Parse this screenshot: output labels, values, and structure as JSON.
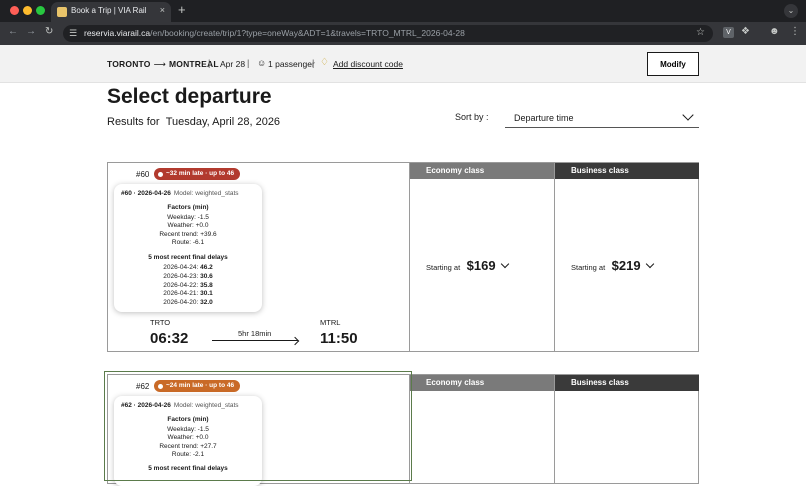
{
  "browser": {
    "tab_title": "Book a Trip | VIA Rail",
    "tab_close": "×",
    "new_tab": "+",
    "url_host": "reservia.viarail.ca",
    "url_path": "/en/booking/create/trip/1?type=oneWay&ADT=1&travels=TRTO_MTRL_2026-04-28",
    "extension_letter": "V"
  },
  "summary": {
    "origin": "TORONTO",
    "destination": "MONTREAL",
    "date": "Apr 28",
    "passengers": "1 passenger",
    "discount_link": "Add discount code",
    "modify_label": "Modify"
  },
  "page": {
    "title": "Select departure",
    "results_prefix": "Results for",
    "results_date": "Tuesday, April 28, 2026",
    "sort_label": "Sort by :",
    "sort_value": "Departure time"
  },
  "trips": [
    {
      "number": "#60",
      "badge": "~32 min late · up to 46",
      "popover": {
        "head": "#60 · 2026-04-26",
        "model": "Model: weighted_stats",
        "factors_title": "Factors (min)",
        "factors": [
          "Weekday: -1.5",
          "Weather: +0.0",
          "Recent trend: +39.6",
          "Route: -6.1"
        ],
        "recent_title": "5 most recent final delays",
        "recent": [
          {
            "date": "2026-04-24:",
            "value": "46.2"
          },
          {
            "date": "2026-04-23:",
            "value": "30.6"
          },
          {
            "date": "2026-04-22:",
            "value": "35.8"
          },
          {
            "date": "2026-04-21:",
            "value": "30.1"
          },
          {
            "date": "2026-04-20:",
            "value": "32.0"
          }
        ]
      },
      "from_code": "TRTO",
      "from_time": "06:32",
      "duration": "5hr 18min",
      "to_code": "MTRL",
      "to_time": "11:50",
      "economy": {
        "label": "Economy class",
        "from": "Starting at",
        "price": "$169"
      },
      "business": {
        "label": "Business class",
        "from": "Starting at",
        "price": "$219"
      }
    },
    {
      "number": "#62",
      "badge": "~24 min late · up to 46",
      "popover": {
        "head": "#62 · 2026-04-26",
        "model": "Model: weighted_stats",
        "factors_title": "Factors (min)",
        "factors": [
          "Weekday: -1.5",
          "Weather: +0.0",
          "Recent trend: +27.7",
          "Route: -2.1"
        ],
        "recent_title": "5 most recent final delays"
      },
      "economy": {
        "label": "Economy class"
      },
      "business": {
        "label": "Business class"
      }
    }
  ],
  "colors": {
    "badge_red": "#b23a2e",
    "badge_orange": "#c96a27",
    "economy_header": "#7a7a7a",
    "business_header": "#3a3a3a"
  }
}
